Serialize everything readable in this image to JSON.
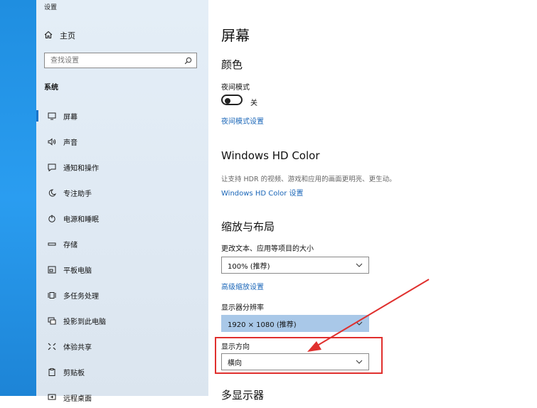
{
  "window": {
    "title": "设置"
  },
  "sidebar": {
    "home_label": "主页",
    "search_placeholder": "查找设置",
    "section": "系统",
    "items": [
      {
        "label": "屏幕",
        "icon": "monitor-icon"
      },
      {
        "label": "声音",
        "icon": "speaker-icon"
      },
      {
        "label": "通知和操作",
        "icon": "notification-icon"
      },
      {
        "label": "专注助手",
        "icon": "moon-icon"
      },
      {
        "label": "电源和睡眠",
        "icon": "power-icon"
      },
      {
        "label": "存储",
        "icon": "storage-icon"
      },
      {
        "label": "平板电脑",
        "icon": "tablet-icon"
      },
      {
        "label": "多任务处理",
        "icon": "multitask-icon"
      },
      {
        "label": "投影到此电脑",
        "icon": "project-icon"
      },
      {
        "label": "体验共享",
        "icon": "share-icon"
      },
      {
        "label": "剪贴板",
        "icon": "clipboard-icon"
      },
      {
        "label": "远程桌面",
        "icon": "remote-icon"
      }
    ],
    "selected_index": 0
  },
  "main": {
    "title": "屏幕",
    "color": {
      "heading": "颜色",
      "night_mode_label": "夜间模式",
      "night_mode_state": "关",
      "night_mode_link": "夜间模式设置"
    },
    "hdr": {
      "heading": "Windows HD Color",
      "description": "让支持 HDR 的视频、游戏和应用的画面更明亮、更生动。",
      "link": "Windows HD Color 设置"
    },
    "scale": {
      "heading": "缩放与布局",
      "text_size_label": "更改文本、应用等项目的大小",
      "text_size_value": "100% (推荐)",
      "advanced_link": "高级缩放设置",
      "resolution_label": "显示器分辨率",
      "resolution_value": "1920 × 1080 (推荐)",
      "orientation_label": "显示方向",
      "orientation_value": "横向"
    },
    "multi_display": {
      "heading": "多显示器"
    }
  },
  "colors": {
    "accent": "#1a66b8",
    "highlight": "#a9c8e8",
    "annotation": "#e0302e"
  }
}
